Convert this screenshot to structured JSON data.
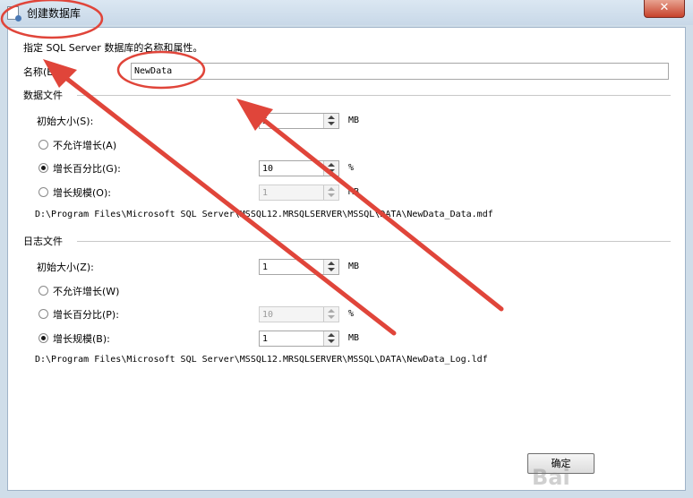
{
  "window": {
    "title": "创建数据库",
    "close_glyph": "✕"
  },
  "form": {
    "description": "指定 SQL Server 数据库的名称和属性。",
    "name_label": "名称(E):",
    "name_value": "NewData"
  },
  "data_file": {
    "section_title": "数据文件",
    "initial_size_label": "初始大小(S):",
    "initial_size_value": "5",
    "initial_size_unit": "MB",
    "no_growth_label": "不允许增长(A)",
    "growth_percent_label": "增长百分比(G):",
    "growth_percent_value": "10",
    "growth_percent_unit": "%",
    "growth_size_label": "增长规模(O):",
    "growth_size_value": "1",
    "growth_size_unit": "MB",
    "selected_growth": "percent",
    "path": "D:\\Program Files\\Microsoft SQL Server\\MSSQL12.MRSQLSERVER\\MSSQL\\DATA\\NewData_Data.mdf"
  },
  "log_file": {
    "section_title": "日志文件",
    "initial_size_label": "初始大小(Z):",
    "initial_size_value": "1",
    "initial_size_unit": "MB",
    "no_growth_label": "不允许增长(W)",
    "growth_percent_label": "增长百分比(P):",
    "growth_percent_value": "10",
    "growth_percent_unit": "%",
    "growth_size_label": "增长规模(B):",
    "growth_size_value": "1",
    "growth_size_unit": "MB",
    "selected_growth": "size",
    "path": "D:\\Program Files\\Microsoft SQL Server\\MSSQL12.MRSQLSERVER\\MSSQL\\DATA\\NewData_Log.ldf"
  },
  "buttons": {
    "ok_label": "确定"
  },
  "watermark": "Bai",
  "colors": {
    "annotation": "#e0453a",
    "close_button": "#c7422b"
  }
}
